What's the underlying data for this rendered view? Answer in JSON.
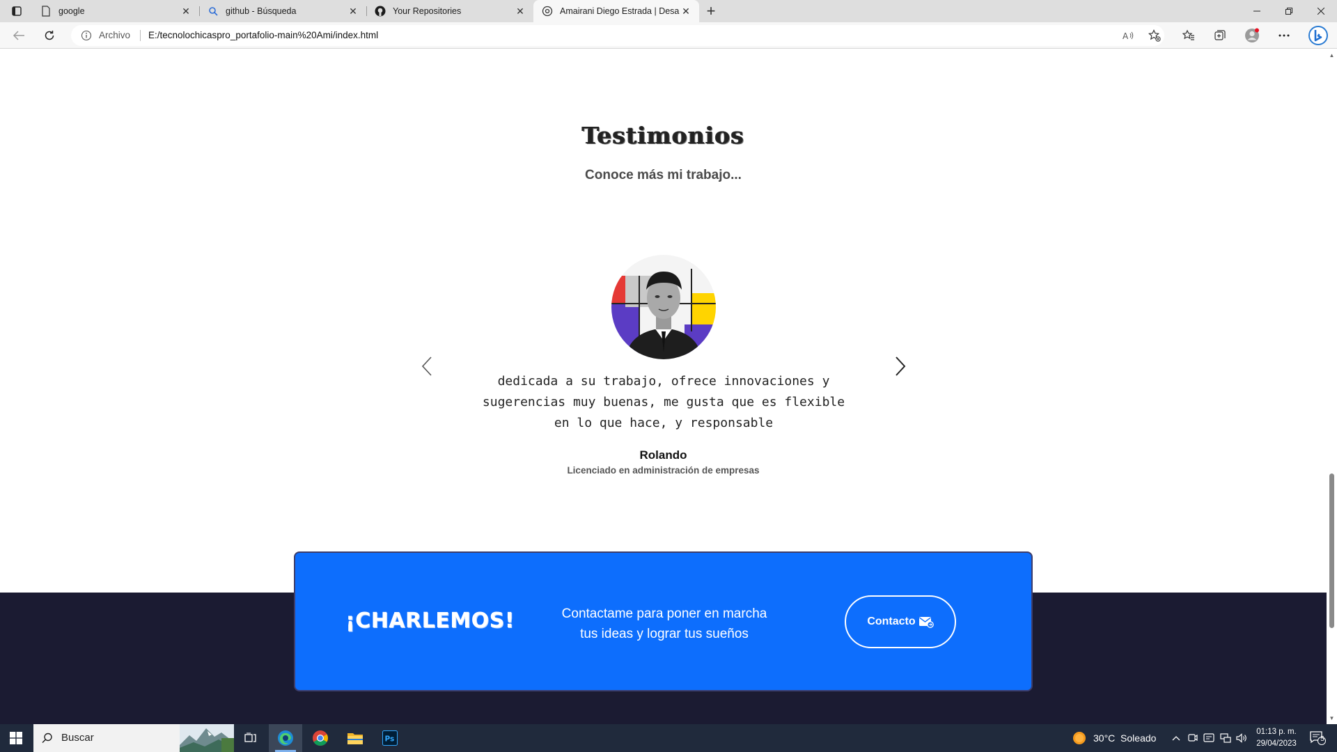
{
  "browser": {
    "tabs": [
      {
        "label": "google",
        "icon": "page-icon"
      },
      {
        "label": "github - Búsqueda",
        "icon": "search-icon"
      },
      {
        "label": "Your Repositories",
        "icon": "github-icon"
      },
      {
        "label": "Amairani Diego Estrada | Desarro",
        "icon": "site-icon",
        "active": true
      }
    ],
    "address": {
      "security_label": "Archivo",
      "url": "E:/tecnolochicaspro_portafolio-main%20Ami/index.html"
    }
  },
  "page": {
    "testimonials": {
      "title": "Testimonios",
      "subtitle": "Conoce más mi trabajo...",
      "quote_line1": "dedicada a su trabajo, ofrece innovaciones y",
      "quote_line2": "sugerencias muy buenas, me gusta que es flexible",
      "quote_line3": "en lo que hace, y responsable",
      "author": "Rolando",
      "role": "Licenciado en administración de empresas"
    },
    "cta": {
      "title": "¡CHARLEMOS!",
      "text_line1": "Contactame para poner en marcha",
      "text_line2": "tus ideas y lograr tus sueños",
      "button_label": "Contacto"
    }
  },
  "taskbar": {
    "search_placeholder": "Buscar",
    "weather": "30°C  Soleado",
    "time": "01:13 p. m.",
    "date": "29/04/2023",
    "notification_count": "5"
  },
  "colors": {
    "cta_blue": "#0d6efd",
    "footer_navy": "#1b1b32",
    "taskbar": "#202a3c"
  }
}
